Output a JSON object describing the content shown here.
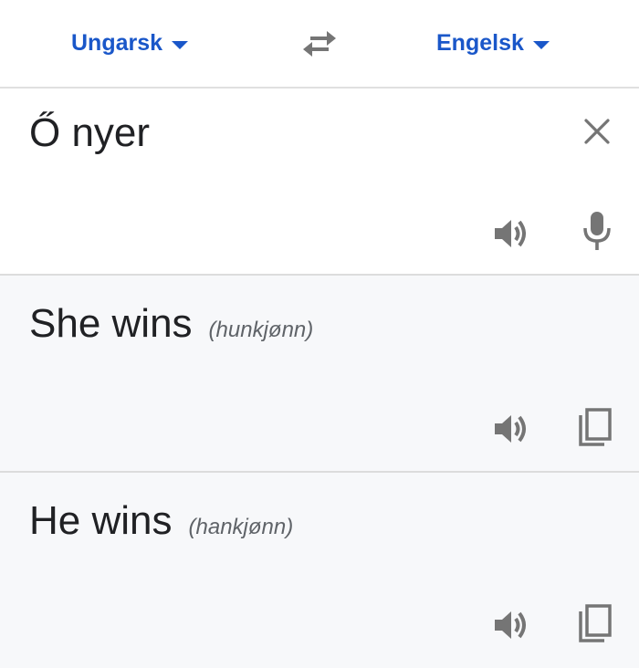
{
  "languages": {
    "source": "Ungarsk",
    "target": "Engelsk"
  },
  "icons": {
    "swap": "swap-arrows-icon",
    "clear": "close-icon",
    "speaker": "speaker-icon",
    "mic": "microphone-icon",
    "copy": "copy-icon"
  },
  "source": {
    "text": "Ő nyer"
  },
  "results": [
    {
      "text": "She wins",
      "gender": "(hunkjønn)"
    },
    {
      "text": "He wins",
      "gender": "(hankjønn)"
    }
  ],
  "colors": {
    "accent": "#1a57c9",
    "icon": "#757575",
    "result_bg": "#f7f8fa"
  }
}
